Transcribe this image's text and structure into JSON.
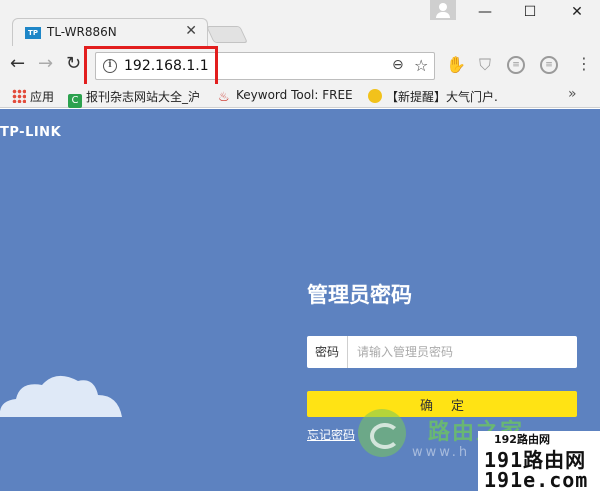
{
  "browser": {
    "tab_title": "TL-WR886N",
    "tab_favicon_text": "TP",
    "url": "192.168.1.1",
    "icons": {
      "back": "arrow-left-icon",
      "forward": "arrow-right-icon",
      "reload": "reload-icon",
      "info": "info-icon",
      "zoom": "zoom-icon",
      "star": "star-icon",
      "menu": "menu-dots-icon"
    },
    "highlight_color": "#e21e1e"
  },
  "bookmarks": {
    "apps": "应用",
    "items": [
      {
        "label": "报刊杂志网站大全_沪"
      },
      {
        "label": "Keyword Tool: FREE"
      },
      {
        "label": "【新提醒】大气门户."
      }
    ]
  },
  "page": {
    "background": "#5d82c0",
    "logo": "TP-LINK",
    "login": {
      "title": "管理员密码",
      "password_label": "密码",
      "password_placeholder": "请输入管理员密码",
      "confirm_button": "确定",
      "forgot_link": "忘记密码"
    },
    "watermark": {
      "site_name": "路由之家",
      "url": "www.h",
      "badge_top": "192路由网",
      "badge_main": "191路由网",
      "badge_sub": "191e.com"
    }
  }
}
